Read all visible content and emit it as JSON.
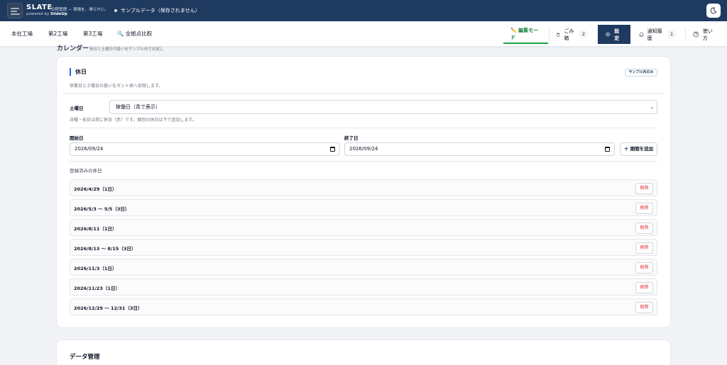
{
  "app": {
    "brand": "SLATE",
    "powered_prefix": "powered by ",
    "powered_name": "SlideUp",
    "tagline": "日程管理 — 現場を、滑らかに。",
    "status": "サンプルデータ（保存されません）"
  },
  "nav": {
    "tabs": [
      "本社工場",
      "第2工場",
      "第3工場",
      "🔍 全拠点比較"
    ],
    "edit_mode": "✏️ 編集モード",
    "trash": "ごみ箱",
    "trash_count": "2",
    "settings": "設定",
    "notifications": "通知履歴",
    "notifications_count": "1",
    "help": "使い方"
  },
  "section": {
    "title": "カレンダー",
    "subtitle": "休日と土曜日の扱いをサンプル内でお試し"
  },
  "holidays": {
    "heading": "休日",
    "sample_badge": "サンプル内のみ",
    "description": "休業日と土曜日の扱いをガント表へ反映します。",
    "saturday_label": "土曜日",
    "saturday_value": "稼働日（青で表示）",
    "saturday_note": "日曜・祝日は常に休日（赤）です。個別の休日は下で追加します。",
    "start_label": "開始日",
    "start_value": "2026/09/24",
    "end_label": "終了日",
    "end_value": "2026/09/24",
    "add_button": "＋ 期間を追加",
    "registered_label": "登録済みの休日",
    "delete_label": "削除",
    "items": [
      "2026/4/29（1日）",
      "2026/5/3 〜 5/5（3日）",
      "2026/8/11（1日）",
      "2026/8/13 〜 8/15（3日）",
      "2026/11/3（1日）",
      "2026/11/23（1日）",
      "2026/12/29 〜 12/31（3日）"
    ]
  },
  "data_mgmt": {
    "title": "データ管理"
  },
  "colors": {
    "header_bg": "#1f3a5f",
    "accent_green": "#16a34a",
    "delete_red": "#dc2626",
    "heading_bar": "#2563eb"
  }
}
